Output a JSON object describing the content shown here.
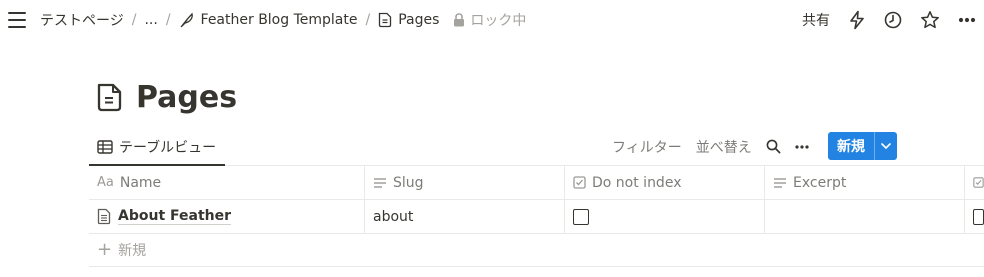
{
  "breadcrumb": {
    "items": [
      "テストページ",
      "...",
      "Feather Blog Template",
      "Pages"
    ],
    "separator": "/",
    "lock_label": "ロック中"
  },
  "top_actions": {
    "share_label": "共有"
  },
  "page": {
    "title": "Pages"
  },
  "view": {
    "tab_label": "テーブルビュー",
    "filter_label": "フィルター",
    "sort_label": "並べ替え",
    "new_label": "新規"
  },
  "table": {
    "columns": [
      {
        "type_icon": "Aa",
        "label": "Name"
      },
      {
        "label": "Slug"
      },
      {
        "label": "Do not index"
      },
      {
        "label": "Excerpt"
      }
    ],
    "rows": [
      {
        "name": "About Feather",
        "slug": "about",
        "do_not_index": false,
        "excerpt": ""
      }
    ],
    "add_row_label": "新規"
  },
  "colors": {
    "accent": "#2383e2",
    "text": "#37352f",
    "muted": "#7d7c78",
    "border": "#e9e9e7"
  }
}
